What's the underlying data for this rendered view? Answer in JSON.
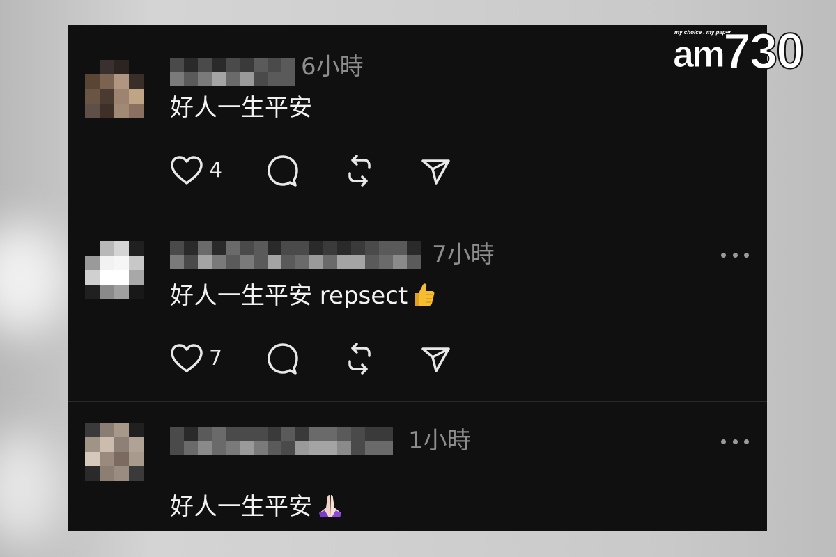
{
  "brand": {
    "tagline": "my choice . my paper",
    "logo_letters": "am",
    "logo_number": "730"
  },
  "posts": [
    {
      "time": "6小時",
      "text": "好人一生平安",
      "emoji": "",
      "likes": "4",
      "avatar_colors": [
        "#101010",
        "#3a3030",
        "#2c2420",
        "#101010",
        "#5a4434",
        "#7a6350",
        "#b09680",
        "#3a2e28",
        "#6a5444",
        "#4a3a30",
        "#9c8470",
        "#c0a486",
        "#5e5048",
        "#3e3028",
        "#a08a74",
        "#8a7060"
      ]
    },
    {
      "time": "7小時",
      "text": "好人一生平安 repsect",
      "emoji": "👍",
      "likes": "7",
      "avatar_colors": [
        "#101010",
        "#b8b8b8",
        "#d4d4d4",
        "#202020",
        "#9a9a9a",
        "#f2f2f2",
        "#f6f6f6",
        "#c8c8c8",
        "#d0d0d0",
        "#ffffff",
        "#ffffff",
        "#a8a8a8",
        "#202020",
        "#8a8a8a",
        "#a0a0a0",
        "#181818"
      ]
    },
    {
      "time": "1小時",
      "text": "好人一生平安",
      "emoji": "🙏",
      "likes": "",
      "avatar_colors": [
        "#3a3a3a",
        "#8a7e74",
        "#a8988a",
        "#202020",
        "#a09486",
        "#cbbcae",
        "#8e8076",
        "#b0a294",
        "#d6c8ba",
        "#9a8a7e",
        "#7a6a60",
        "#a89a8c",
        "#2a2a2a",
        "#8c7e72",
        "#9a8c80",
        "#3a3a3a"
      ]
    }
  ],
  "icons": {
    "like": "heart-icon",
    "reply": "comment-icon",
    "repost": "repost-icon",
    "share": "send-icon",
    "more": "more-icon"
  },
  "colors": {
    "panel_bg": "#101010",
    "text": "#f2f2f2",
    "muted": "#8d8d8d"
  }
}
